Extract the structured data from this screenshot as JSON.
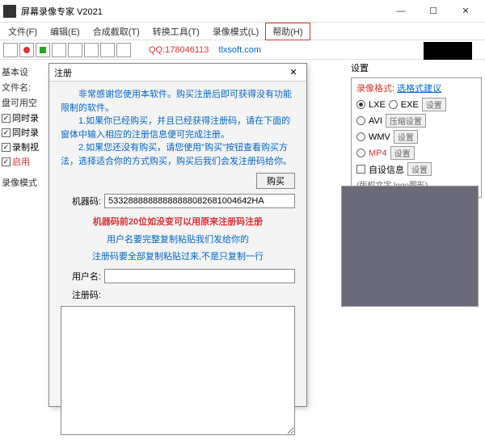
{
  "window": {
    "title": "屏幕录像专家 V2021",
    "min": "—",
    "max": "☐",
    "close": "✕"
  },
  "menu": {
    "file": "文件(F)",
    "edit": "编辑(E)",
    "capture": "合成截取(T)",
    "convert": "转换工具(T)",
    "recmode": "录像模式(L)",
    "help": "帮助(H)"
  },
  "toolbar": {
    "qq": "QQ:178046113",
    "site": "tlxsoft.com"
  },
  "left": {
    "basic": "基本设",
    "filename": "文件名:",
    "tempspace": "盘可用空",
    "cb1": "同时录",
    "cb2": "同时录",
    "cb3": "录制视",
    "enable": "启用",
    "recmode": "录像模式"
  },
  "right": {
    "settings": "设置",
    "format_label": "录像格式:",
    "format_link": "选格式建议",
    "lxe": "LXE",
    "exe": "EXE",
    "avi": "AVI",
    "wmv": "WMV",
    "mp4": "MP4",
    "btn_set": "设置",
    "btn_compress": "压缩设置",
    "selfinfo": "自设信息",
    "copyright": "(版权文字 logo图形)"
  },
  "dialog": {
    "title": "注册",
    "close": "✕",
    "intro": "　　非常感谢您使用本软件。购买注册后即可获得没有功能限制的软件。\n　　1.如果你已经购买，并且已经获得注册码，请在下面的窗体中输入相应的注册信息便可完成注册。\n　　2.如果您还没有购买，请您使用\"购买\"按钮查看购买方法，选择适合你的方式购买，购买后我们会发注册码给你。",
    "buy": "购买",
    "machine_label": "机器码:",
    "machine_value": "53328888888888888082681004642HA",
    "warn": "机器码前20位如没变可以用原来注册码注册",
    "note1": "用户名要完整复制粘贴我们发给你的",
    "note2": "注册码要全部复制粘贴过来,不是只复制一行",
    "user_label": "用户名:",
    "code_label": "注册码:"
  }
}
